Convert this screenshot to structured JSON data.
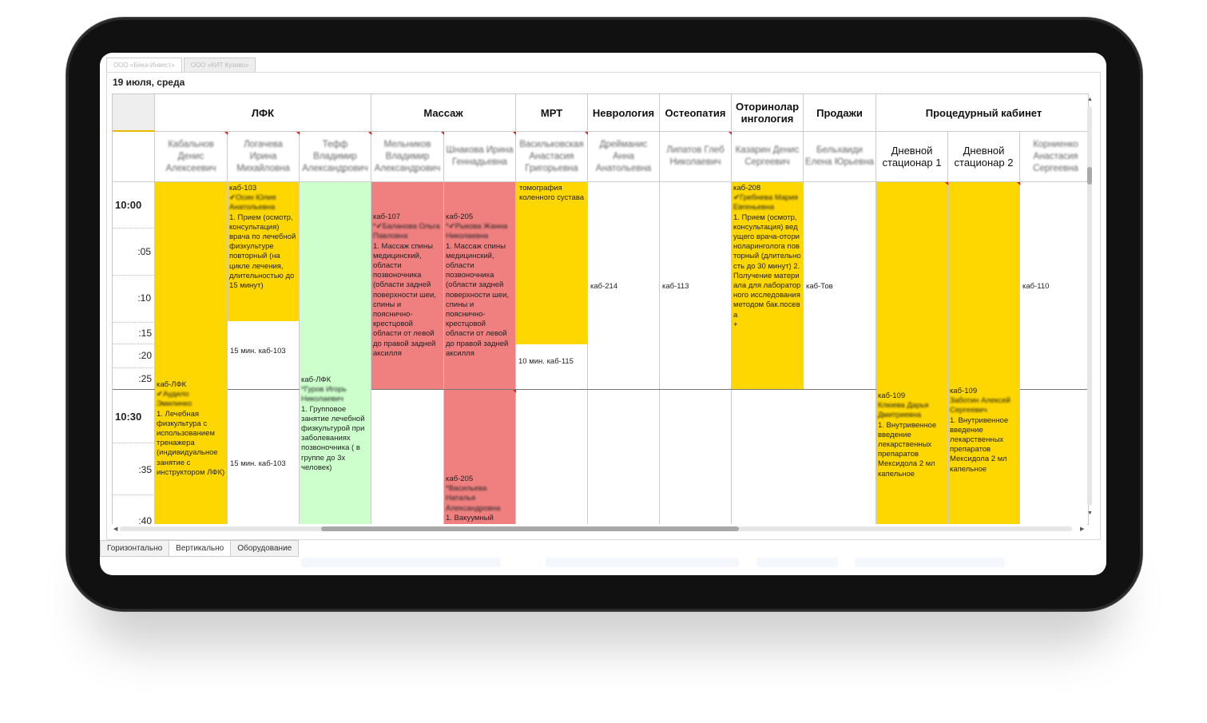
{
  "tabs": [
    "ООО «Бека-Инвест»",
    "ООО «КИТ Кузаво»"
  ],
  "date": "19 июля, среда",
  "departments": [
    "ЛФК",
    "Массаж",
    "МРТ",
    "Неврология",
    "Остеопатия",
    "Оториноларингология",
    "Продажи",
    "Процедурный кабинет"
  ],
  "doctors": [
    "Кабальнов Денис Алексеевич",
    "Логачева Ирина Михайловна",
    "Тефф Владимир Александрович",
    "Мельников Владимир Александрович",
    "Шнакова Ирина Геннадьевна",
    "Васильковская Анастасия Григорьевна",
    "Дрейманис Анна Анатольевна",
    "Липатов Глеб Николаевич",
    "Казарин Денис Сергеевич",
    "Бельхаиди Елена Юрьевна",
    "Дневной стационар 1",
    "Дневной стационар 2",
    "Корниенко Анастасия Сергеевна"
  ],
  "times": [
    "10:00",
    ":05",
    ":10",
    ":15",
    ":20",
    ":25",
    "10:30",
    ":35",
    ":40"
  ],
  "events": {
    "e1": {
      "room": "каб-ЛФК",
      "name": "✔Аудило Эмилинко",
      "desc": "1. Лечебная физкультура с использованием тренажера (индивидуальное занятие с инструктором ЛФК)"
    },
    "e2": {
      "room": "каб-103",
      "name": "✔Осин Юлия Анатольевна",
      "desc": "1. Прием (осмотр, консультация) врача по лечебной физкультуре повторный (на цикле лечения, длительностью до 15 минут)"
    },
    "e3": {
      "text": "15 мин. каб-103"
    },
    "e4": {
      "text": "15 мин. каб-103"
    },
    "e5": {
      "room": "каб-ЛФК",
      "name": "*Гуров Игорь Николаевич",
      "desc": "1. Групповое занятие лечебной физкультурой при заболеваниях позвоночника ( в группе до 3х человек)"
    },
    "e6": {
      "room": "каб-107",
      "name": "*✔Баланова Ольга Павловна",
      "desc": "1. Массаж спины медицинский, области позвоночника (области задней поверхности шеи, спины и пояснично-крестцовой области от левой до правой задней аксилля"
    },
    "e7": {
      "room": "каб-205",
      "name": "*✔Рыкова Жанна Николаевна",
      "desc": "1. Массаж спины медицинский, области позвоночника (области задней поверхности шеи, спины и пояснично-крестцовой области от левой до правой задней аксилля"
    },
    "e8": {
      "room": "каб-205",
      "name": "*Васильева Наталья Александровна",
      "desc": "1. Вакуумный"
    },
    "e9": {
      "desc": "томография коленного сустава"
    },
    "e10": {
      "text": "10 мин. каб-115"
    },
    "e11": {
      "text": "каб-214"
    },
    "e12": {
      "text": "каб-113"
    },
    "e13": {
      "room": "каб-208",
      "name": "✔Гребнева Мария Евгеньевна",
      "desc": "1. Прием (осмотр, консультация) ведущего врача-оториноларинголога повторный (длительность до 30 минут) 2. Получение материала для лабораторного исследования методом бак.посева",
      "plus": "+"
    },
    "e14": {
      "text": "каб-Тов"
    },
    "e15": {
      "room": "каб-109",
      "name": "Клюева Дарья Дмитриевна",
      "desc": "1. Внутривенное введение лекарственных препаратов Мексидола 2 мл капельное"
    },
    "e16": {
      "room": "каб-109",
      "name": "Заботин Алексей Сергеевич",
      "desc": "1. Внутривенное введение лекарственных препаратов Мексидола 2 мл капельное"
    },
    "e17": {
      "text": "каб-110"
    }
  },
  "bottom_tabs": [
    "Горизонтально",
    "Вертикально",
    "Оборудование"
  ],
  "colors": {
    "yellow": "#ffd700",
    "green": "#ccffcc",
    "red": "#f08080"
  }
}
